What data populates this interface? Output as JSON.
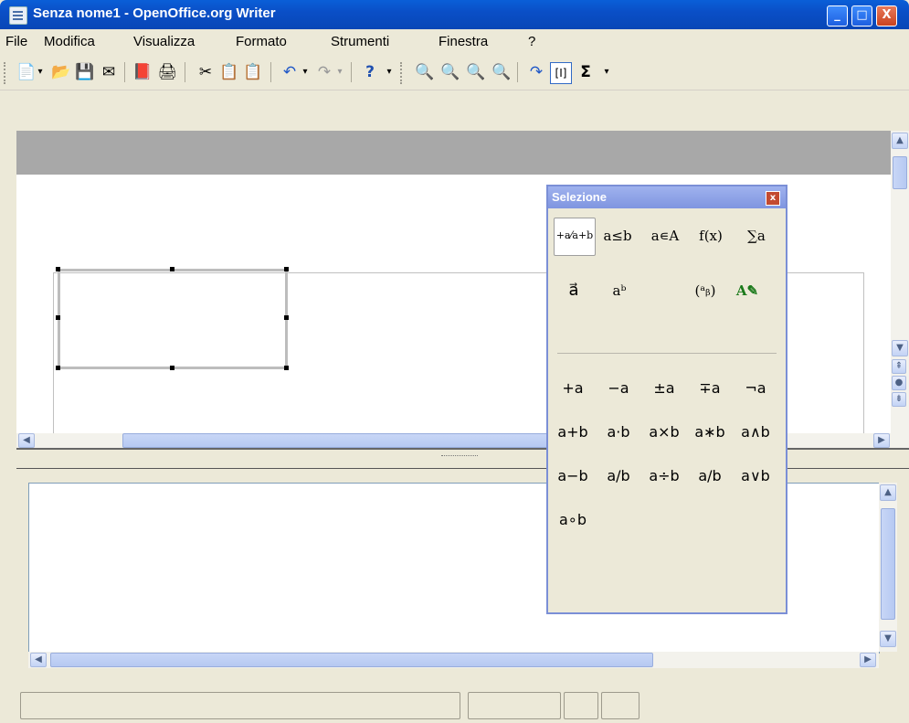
{
  "window": {
    "title": "Senza nome1 - OpenOffice.org Writer",
    "minimize_label": "_",
    "maximize_label": "□",
    "close_label": "X"
  },
  "menu": [
    "File",
    "Modifica",
    "Visualizza",
    "Formato",
    "Strumenti",
    "Finestra",
    "?"
  ],
  "toolbar": {
    "icons": [
      "📄",
      "▾",
      "📂",
      "💾",
      "✉",
      "📕",
      "🖨",
      "✂",
      "📋",
      "📋",
      "↶",
      "▾",
      "↷",
      "▾",
      "?",
      "▾",
      "🔍",
      "🔍",
      "🔍",
      "🔍",
      "↷",
      "[I]",
      "Σ",
      "▾"
    ]
  },
  "palette": {
    "title": "Selezione",
    "close_label": "x",
    "categories": [
      "+a⁄a+b",
      "a≤b",
      "a∊A",
      "f(x)",
      "∑a",
      "a⃗",
      "aᵇ",
      "(ᵃᵦ)",
      "A✎"
    ],
    "symbols": [
      "+a",
      "−a",
      "±a",
      "∓a",
      "¬a",
      "a+b",
      "a·b",
      "a×b",
      "a∗b",
      "a∧b",
      "a−b",
      "a/b",
      "a÷b",
      "a/b",
      "a∨b",
      "a∘b"
    ]
  },
  "colors": {
    "titlebar": "#0a4fc7",
    "palette_border": "#7b8fd6",
    "ruler": "#a8a8a8"
  }
}
